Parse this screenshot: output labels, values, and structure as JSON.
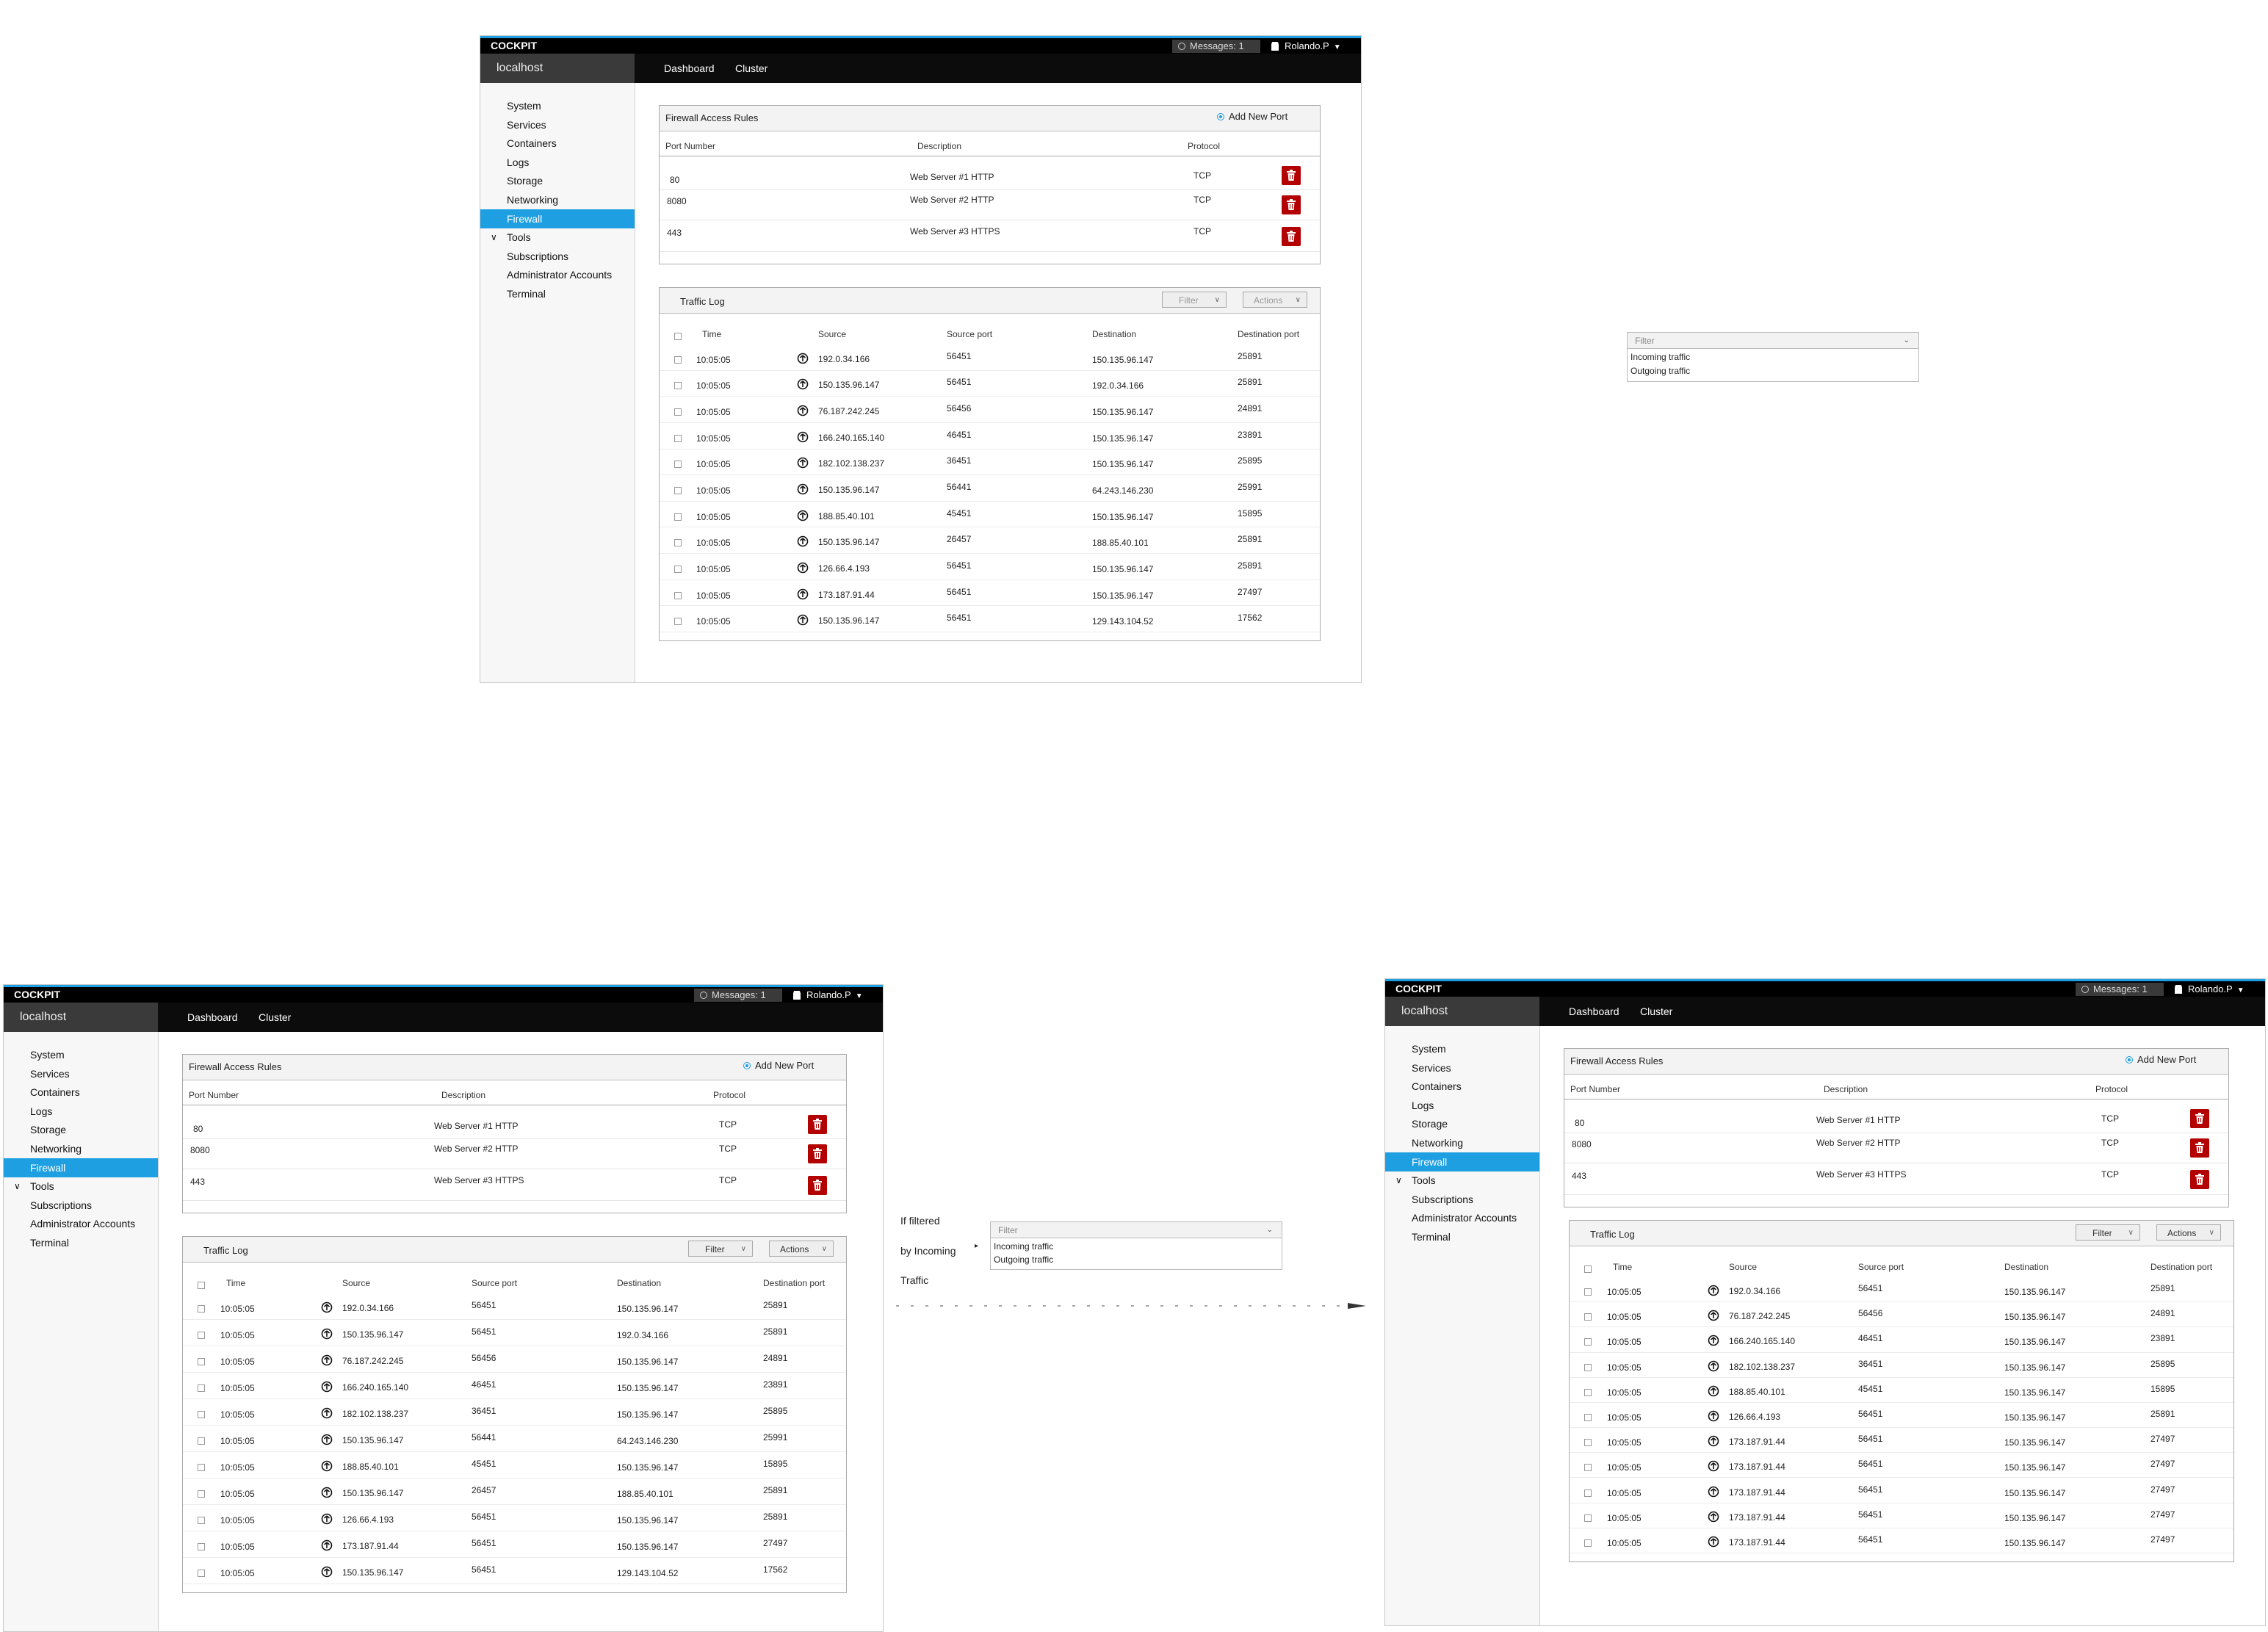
{
  "app": {
    "brand": "COCKPIT",
    "messages_label": "Messages: 1",
    "user_name": "Rolando.P",
    "host": "localhost",
    "nav": [
      "Dashboard",
      "Cluster"
    ]
  },
  "sidebar": {
    "items": [
      "System",
      "Services",
      "Containers",
      "Logs",
      "Storage",
      "Networking",
      "Firewall",
      "Tools",
      "Subscriptions",
      "Administrator Accounts",
      "Terminal"
    ],
    "active": "Firewall",
    "expandable": "Tools"
  },
  "firewall": {
    "title": "Firewall Access Rules",
    "add_port": "Add New Port",
    "columns": [
      "Port Number",
      "Description",
      "Protocol"
    ],
    "rows": [
      {
        "port": "80",
        "description": "Web Server  #1 HTTP",
        "protocol": "TCP"
      },
      {
        "port": "8080",
        "description": "Web Server #2 HTTP",
        "protocol": "TCP"
      },
      {
        "port": "443",
        "description": "Web Server #3 HTTPS",
        "protocol": "TCP"
      }
    ]
  },
  "traffic": {
    "title": "Traffic Log",
    "filter_label": "Filter",
    "actions_label": "Actions",
    "columns": [
      "Time",
      "Source",
      "Source port",
      "Destination",
      "Destination port"
    ],
    "rows": [
      {
        "time": "10:05:05",
        "source": "192.0.34.166",
        "sport": "56451",
        "dest": "150.135.96.147",
        "dport": "25891"
      },
      {
        "time": "10:05:05",
        "source": "150.135.96.147",
        "sport": "56451",
        "dest": "192.0.34.166",
        "dport": "25891"
      },
      {
        "time": "10:05:05",
        "source": "76.187.242.245",
        "sport": "56456",
        "dest": "150.135.96.147",
        "dport": "24891"
      },
      {
        "time": "10:05:05",
        "source": "166.240.165.140",
        "sport": "46451",
        "dest": "150.135.96.147",
        "dport": "23891"
      },
      {
        "time": "10:05:05",
        "source": "182.102.138.237",
        "sport": "36451",
        "dest": "150.135.96.147",
        "dport": "25895"
      },
      {
        "time": "10:05:05",
        "source": "150.135.96.147",
        "sport": "56441",
        "dest": "64.243.146.230",
        "dport": "25991"
      },
      {
        "time": "10:05:05",
        "source": "188.85.40.101",
        "sport": "45451",
        "dest": "150.135.96.147",
        "dport": "15895"
      },
      {
        "time": "10:05:05",
        "source": "150.135.96.147",
        "sport": "26457",
        "dest": "188.85.40.101",
        "dport": "25891"
      },
      {
        "time": "10:05:05",
        "source": "126.66.4.193",
        "sport": "56451",
        "dest": "150.135.96.147",
        "dport": "25891"
      },
      {
        "time": "10:05:05",
        "source": "173.187.91.44",
        "sport": "56451",
        "dest": "150.135.96.147",
        "dport": "27497"
      },
      {
        "time": "10:05:05",
        "source": "150.135.96.147",
        "sport": "56451",
        "dest": "129.143.104.52",
        "dport": "17562"
      }
    ],
    "filtered_rows": [
      {
        "time": "10:05:05",
        "source": "192.0.34.166",
        "sport": "56451",
        "dest": "150.135.96.147",
        "dport": "25891"
      },
      {
        "time": "10:05:05",
        "source": "76.187.242.245",
        "sport": "56456",
        "dest": "150.135.96.147",
        "dport": "24891"
      },
      {
        "time": "10:05:05",
        "source": "166.240.165.140",
        "sport": "46451",
        "dest": "150.135.96.147",
        "dport": "23891"
      },
      {
        "time": "10:05:05",
        "source": "182.102.138.237",
        "sport": "36451",
        "dest": "150.135.96.147",
        "dport": "25895"
      },
      {
        "time": "10:05:05",
        "source": "188.85.40.101",
        "sport": "45451",
        "dest": "150.135.96.147",
        "dport": "15895"
      },
      {
        "time": "10:05:05",
        "source": "126.66.4.193",
        "sport": "56451",
        "dest": "150.135.96.147",
        "dport": "25891"
      },
      {
        "time": "10:05:05",
        "source": "173.187.91.44",
        "sport": "56451",
        "dest": "150.135.96.147",
        "dport": "27497"
      },
      {
        "time": "10:05:05",
        "source": "173.187.91.44",
        "sport": "56451",
        "dest": "150.135.96.147",
        "dport": "27497"
      },
      {
        "time": "10:05:05",
        "source": "173.187.91.44",
        "sport": "56451",
        "dest": "150.135.96.147",
        "dport": "27497"
      },
      {
        "time": "10:05:05",
        "source": "173.187.91.44",
        "sport": "56451",
        "dest": "150.135.96.147",
        "dport": "27497"
      },
      {
        "time": "10:05:05",
        "source": "173.187.91.44",
        "sport": "56451",
        "dest": "150.135.96.147",
        "dport": "27497"
      }
    ]
  },
  "filter_menu": {
    "placeholder": "Filter",
    "options": [
      "Incoming traffic",
      "Outgoing traffic"
    ]
  },
  "annotation": {
    "lines": [
      "If filtered",
      "by Incoming",
      "Traffic"
    ]
  },
  "colors": {
    "accent": "#1e9fe1",
    "topbar": "#000000",
    "delete": "#b30000"
  }
}
